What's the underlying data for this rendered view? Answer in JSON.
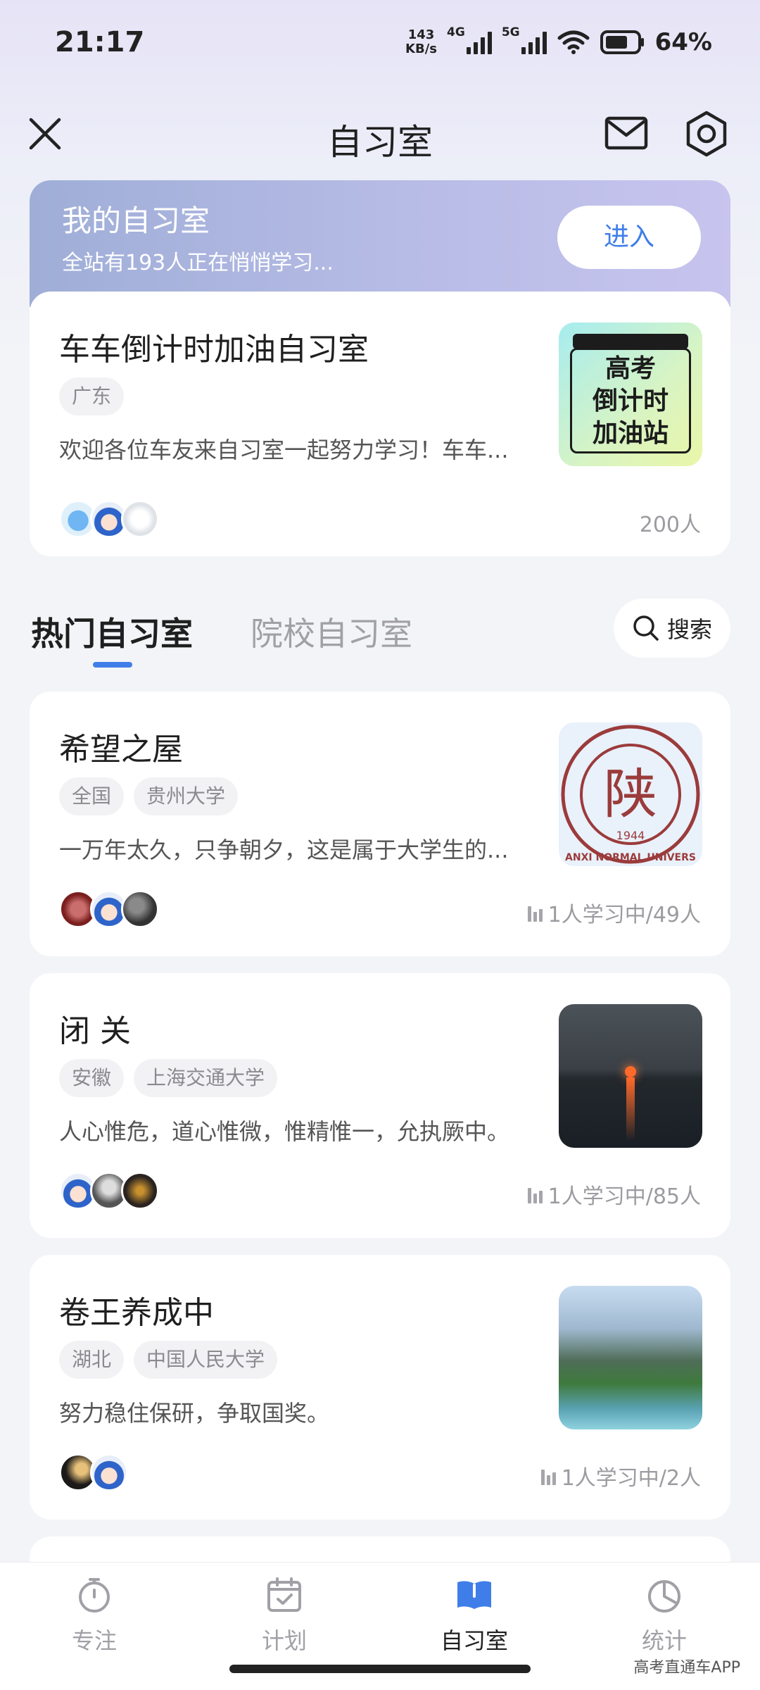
{
  "status_bar": {
    "time": "21:17",
    "net_speed_value": "143",
    "net_speed_unit": "KB/s",
    "net_type_1": "4G",
    "net_type_2": "5G",
    "battery": "64%"
  },
  "header": {
    "title": "自习室"
  },
  "my_room": {
    "banner_title": "我的自习室",
    "banner_subtitle": "全站有193人正在悄悄学习...",
    "enter_label": "进入",
    "room": {
      "name": "车车倒计时加油自习室",
      "tags": [
        "广东"
      ],
      "description": "欢迎各位车友来自习室一起努力学习！车车...",
      "member_count": "200人",
      "thumb_text": [
        "高考",
        "倒计时",
        "加油站"
      ]
    }
  },
  "tabs": {
    "hot": "热门自习室",
    "school": "院校自习室",
    "search_label": "搜索"
  },
  "rooms": [
    {
      "name": "希望之屋",
      "tags": [
        "全国",
        "贵州大学"
      ],
      "description": "一万年太久，只争朝夕，这是属于大学生的...",
      "status": "1人学习中/49人",
      "thumb_text": "陕",
      "thumb_year": "1944",
      "thumb_arc": "ANXI NORMAL UNIVERS"
    },
    {
      "name": " 闭 关",
      "tags": [
        "安徽",
        "上海交通大学"
      ],
      "description": "人心惟危，道心惟微，惟精惟一，允执厥中。",
      "status": "1人学习中/85人"
    },
    {
      "name": "卷王养成中",
      "tags": [
        "湖北",
        "中国人民大学"
      ],
      "description": "努力稳住保研，争取国奖。",
      "status": "1人学习中/2人"
    }
  ],
  "bottom_nav": [
    {
      "label": "专注",
      "icon": "stopwatch-icon"
    },
    {
      "label": "计划",
      "icon": "calendar-check-icon"
    },
    {
      "label": "自习室",
      "icon": "book-icon"
    },
    {
      "label": "统计",
      "icon": "pie-chart-icon"
    }
  ],
  "watermark": "高考直通车APP",
  "colors": {
    "accent": "#3f7ee8",
    "banner": "#a9b4e0"
  }
}
